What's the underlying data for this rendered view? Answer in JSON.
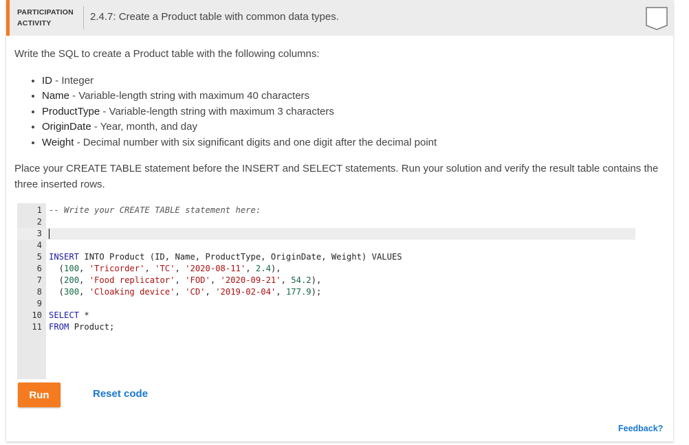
{
  "header": {
    "activity_label": "PARTICIPATION\nACTIVITY",
    "title": "2.4.7: Create a Product table with common data types."
  },
  "content": {
    "intro": "Write the SQL to create a Product table with the following columns:",
    "columns": [
      {
        "name": "ID",
        "desc": " - Integer"
      },
      {
        "name": "Name",
        "desc": " - Variable-length string with maximum 40 characters"
      },
      {
        "name": "ProductType",
        "desc": " - Variable-length string with maximum 3 characters"
      },
      {
        "name": "OriginDate",
        "desc": " - Year, month, and day"
      },
      {
        "name": "Weight",
        "desc": " - Decimal number with six significant digits and one digit after the decimal point"
      }
    ],
    "instructions": "Place your CREATE TABLE statement before the INSERT and SELECT statements. Run your solution and verify the result table contains the three inserted rows."
  },
  "editor": {
    "lines": [
      {
        "n": "1",
        "code": "-- Write your CREATE TABLE statement here:"
      },
      {
        "n": "2",
        "code": ""
      },
      {
        "n": "3",
        "code": ""
      },
      {
        "n": "4",
        "code": ""
      },
      {
        "n": "5",
        "code": "INSERT INTO Product (ID, Name, ProductType, OriginDate, Weight) VALUES"
      },
      {
        "n": "6",
        "code": "  (100, 'Tricorder', 'TC', '2020-08-11', 2.4),"
      },
      {
        "n": "7",
        "code": "  (200, 'Food replicator', 'FOD', '2020-09-21', 54.2),"
      },
      {
        "n": "8",
        "code": "  (300, 'Cloaking device', 'CD', '2019-02-04', 177.9);"
      },
      {
        "n": "9",
        "code": ""
      },
      {
        "n": "10",
        "code": "SELECT *"
      },
      {
        "n": "11",
        "code": "FROM Product;"
      }
    ]
  },
  "actions": {
    "run_label": "Run",
    "reset_label": "Reset code",
    "feedback_label": "Feedback?"
  },
  "colors": {
    "accent": "#f47b20",
    "link": "#1976d2"
  }
}
